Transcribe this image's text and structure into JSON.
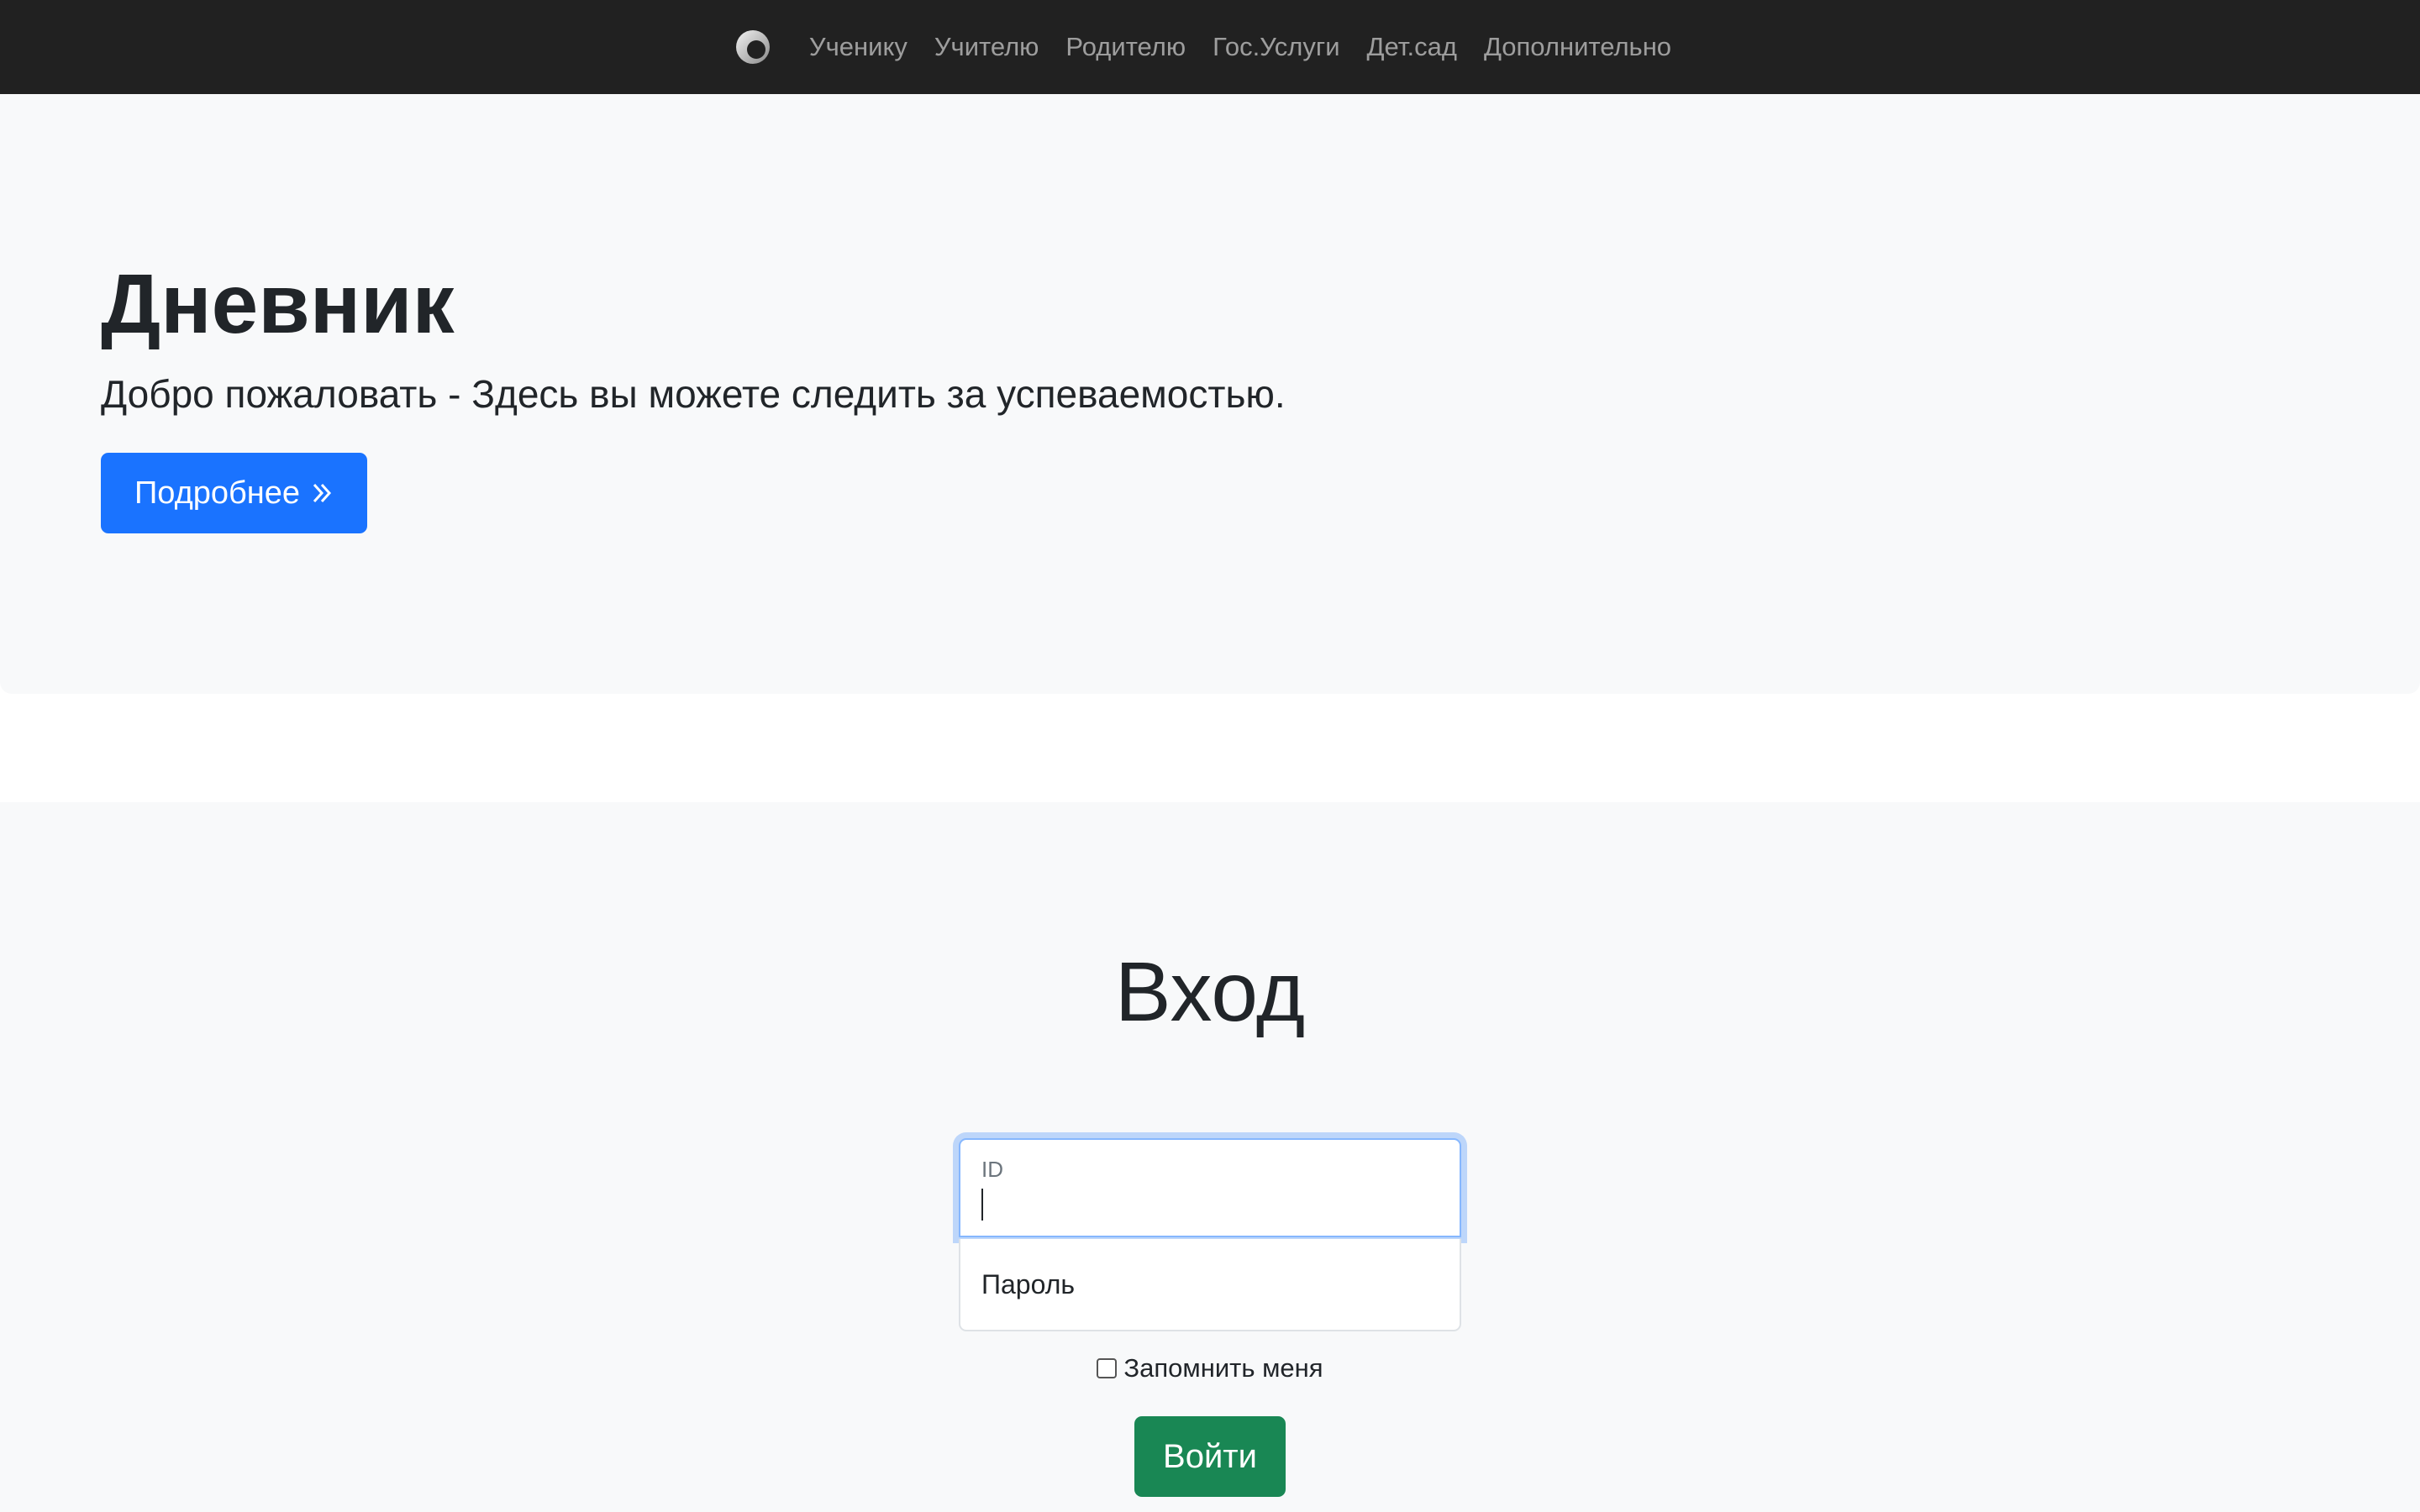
{
  "navbar": {
    "logo_icon": "brand-swirl-logo",
    "items": [
      {
        "label": "Ученику"
      },
      {
        "label": "Учителю"
      },
      {
        "label": "Родителю"
      },
      {
        "label": "Гос.Услуги"
      },
      {
        "label": "Дет.сад"
      },
      {
        "label": "Дополнительно"
      }
    ]
  },
  "hero": {
    "title": "Дневник",
    "lead": "Добро пожаловать - Здесь вы можете следить за успеваемостью.",
    "more_button": {
      "label": "Подробнее",
      "icon": "chevron-double-right-icon"
    }
  },
  "login": {
    "heading": "Вход",
    "id_field": {
      "label": "ID",
      "value": ""
    },
    "password_field": {
      "placeholder": "Пароль",
      "value": ""
    },
    "remember_me": {
      "label": "Запомнить меня",
      "checked": false
    },
    "submit_label": "Войти"
  },
  "colors": {
    "navbar_bg": "#212121",
    "section_bg": "#f8f9fa",
    "primary": "#1a73ff",
    "success": "#198754",
    "focus_ring": "#86b7fe"
  }
}
